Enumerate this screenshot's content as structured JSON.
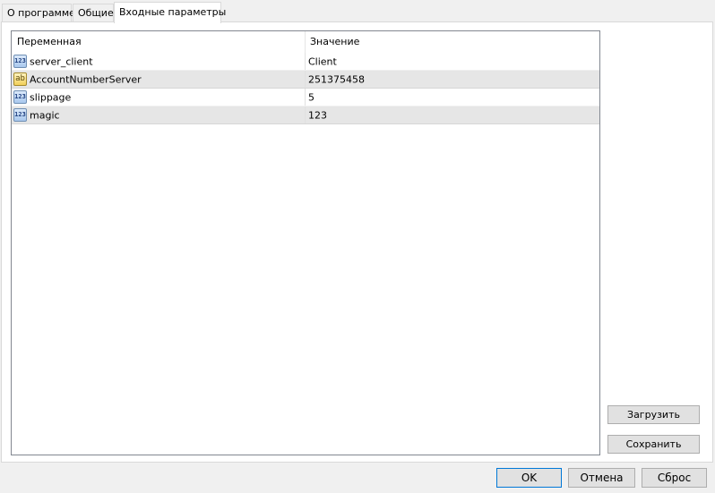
{
  "tabs": [
    {
      "label": "О программе",
      "active": false
    },
    {
      "label": "Общие",
      "active": false
    },
    {
      "label": "Входные параметры",
      "active": true
    }
  ],
  "grid": {
    "columns": [
      "Переменная",
      "Значение"
    ],
    "rows": [
      {
        "icon": "int-type-icon",
        "icon_text": "123",
        "name": "server_client",
        "value": "Client"
      },
      {
        "icon": "string-type-icon",
        "icon_text": "ab",
        "name": "AccountNumberServer",
        "value": "251375458"
      },
      {
        "icon": "int-type-icon",
        "icon_text": "123",
        "name": "slippage",
        "value": "5"
      },
      {
        "icon": "int-type-icon",
        "icon_text": "123",
        "name": "magic",
        "value": "123"
      }
    ]
  },
  "buttons": {
    "load": "Загрузить",
    "save": "Сохранить",
    "ok": "OK",
    "cancel": "Отмена",
    "reset": "Сброс"
  }
}
